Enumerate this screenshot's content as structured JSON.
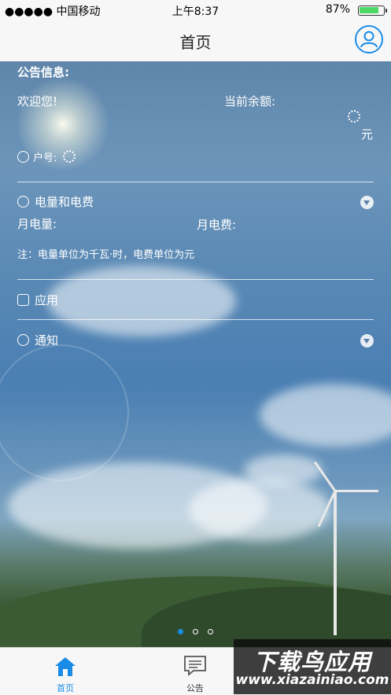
{
  "status_bar": {
    "carrier": "●●●●● 中国移动",
    "time": "上午8:37",
    "battery": "87%",
    "battery_level": 0.87
  },
  "nav": {
    "title": "首页",
    "profile_icon": "user-profile-icon"
  },
  "announcement": {
    "title": "公告信息:",
    "welcome": "欢迎您!",
    "balance_label": "当前余额:",
    "balance_unit": "元",
    "account_label": "户号:"
  },
  "usage": {
    "title": "电量和电费",
    "kwh_label": "月电量:",
    "fee_label": "月电费:",
    "note": "注：电量单位为千瓦·时，电费单位为元"
  },
  "apps": {
    "title": "应用"
  },
  "notice": {
    "title": "通知"
  },
  "carousel": {
    "pages": 3,
    "active": 1
  },
  "tabs": [
    {
      "label": "首页",
      "icon": "home-icon",
      "active": true
    },
    {
      "label": "公告",
      "icon": "message-icon",
      "active": false
    }
  ],
  "watermark": {
    "line1": "下载鸟应用",
    "line2": "www.xiazainiao.com"
  },
  "colors": {
    "accent": "#1a8ce8",
    "battery": "#4cd964"
  }
}
